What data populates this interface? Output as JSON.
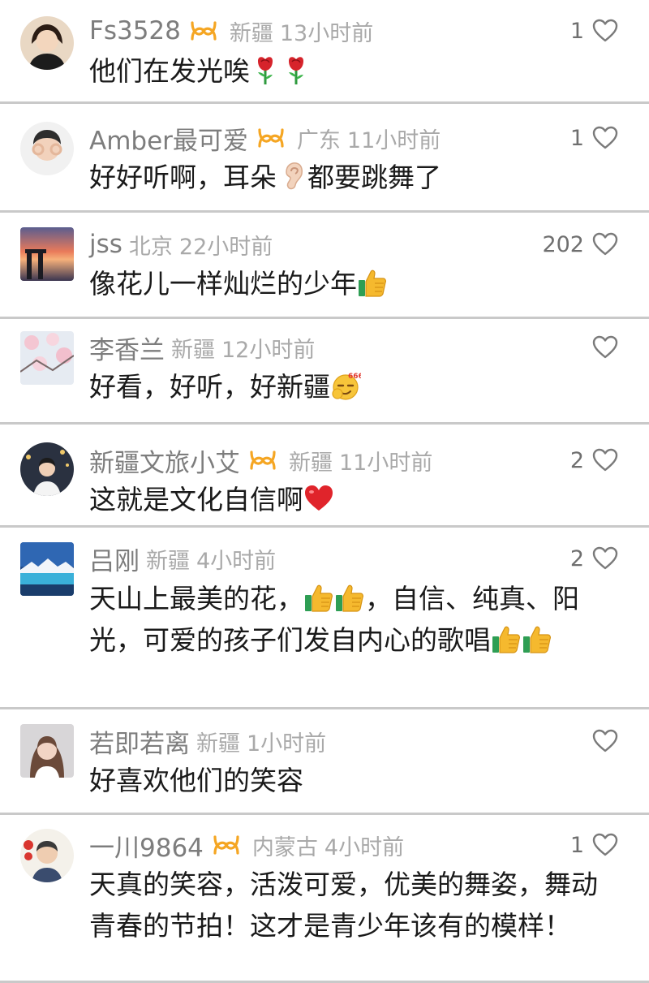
{
  "comments": [
    {
      "name": "Fs3528",
      "badge": true,
      "location": "新疆",
      "time": "13小时前",
      "likes": "1",
      "text": [
        "他们在发光唉",
        "🌹",
        "🌹"
      ]
    },
    {
      "name": "Amber最可爱",
      "badge": true,
      "location": "广东",
      "time": "11小时前",
      "likes": "1",
      "text": [
        "好好听啊，耳朵",
        "👂",
        "都要跳舞了"
      ]
    },
    {
      "name": "jss",
      "badge": false,
      "location": "北京",
      "time": "22小时前",
      "likes": "202",
      "text": [
        "像花儿一样灿烂的少年",
        "👍"
      ]
    },
    {
      "name": "李香兰",
      "badge": false,
      "location": "新疆",
      "time": "12小时前",
      "likes": "",
      "text": [
        "好看，好听，好新疆",
        "666"
      ]
    },
    {
      "name": "新疆文旅小艾",
      "badge": true,
      "location": "新疆",
      "time": "11小时前",
      "likes": "2",
      "text": [
        "这就是文化自信啊",
        "❤️"
      ]
    },
    {
      "name": "吕刚",
      "badge": false,
      "location": "新疆",
      "time": "4小时前",
      "likes": "2",
      "text": [
        "天山上最美的花，",
        "👍",
        "👍",
        "，自信、纯真、阳光，可爱的孩子们发自内心的歌唱",
        "👍",
        "👍"
      ]
    },
    {
      "name": "若即若离",
      "badge": false,
      "location": "新疆",
      "time": "1小时前",
      "likes": "",
      "text": [
        "好喜欢他们的笑容"
      ]
    },
    {
      "name": "一川9864",
      "badge": true,
      "location": "内蒙古",
      "time": "4小时前",
      "likes": "1",
      "text": [
        "天真的笑容，活泼可爱，优美的舞姿，舞动青春的节拍！这才是青少年该有的模样！"
      ]
    }
  ],
  "colors": {
    "badge": "#f5a623",
    "heart": "#7a7a7a",
    "divider": "#c9c9c9"
  },
  "icons": {
    "heart": "heart-outline-icon",
    "badge": "creator-badge-icon"
  }
}
